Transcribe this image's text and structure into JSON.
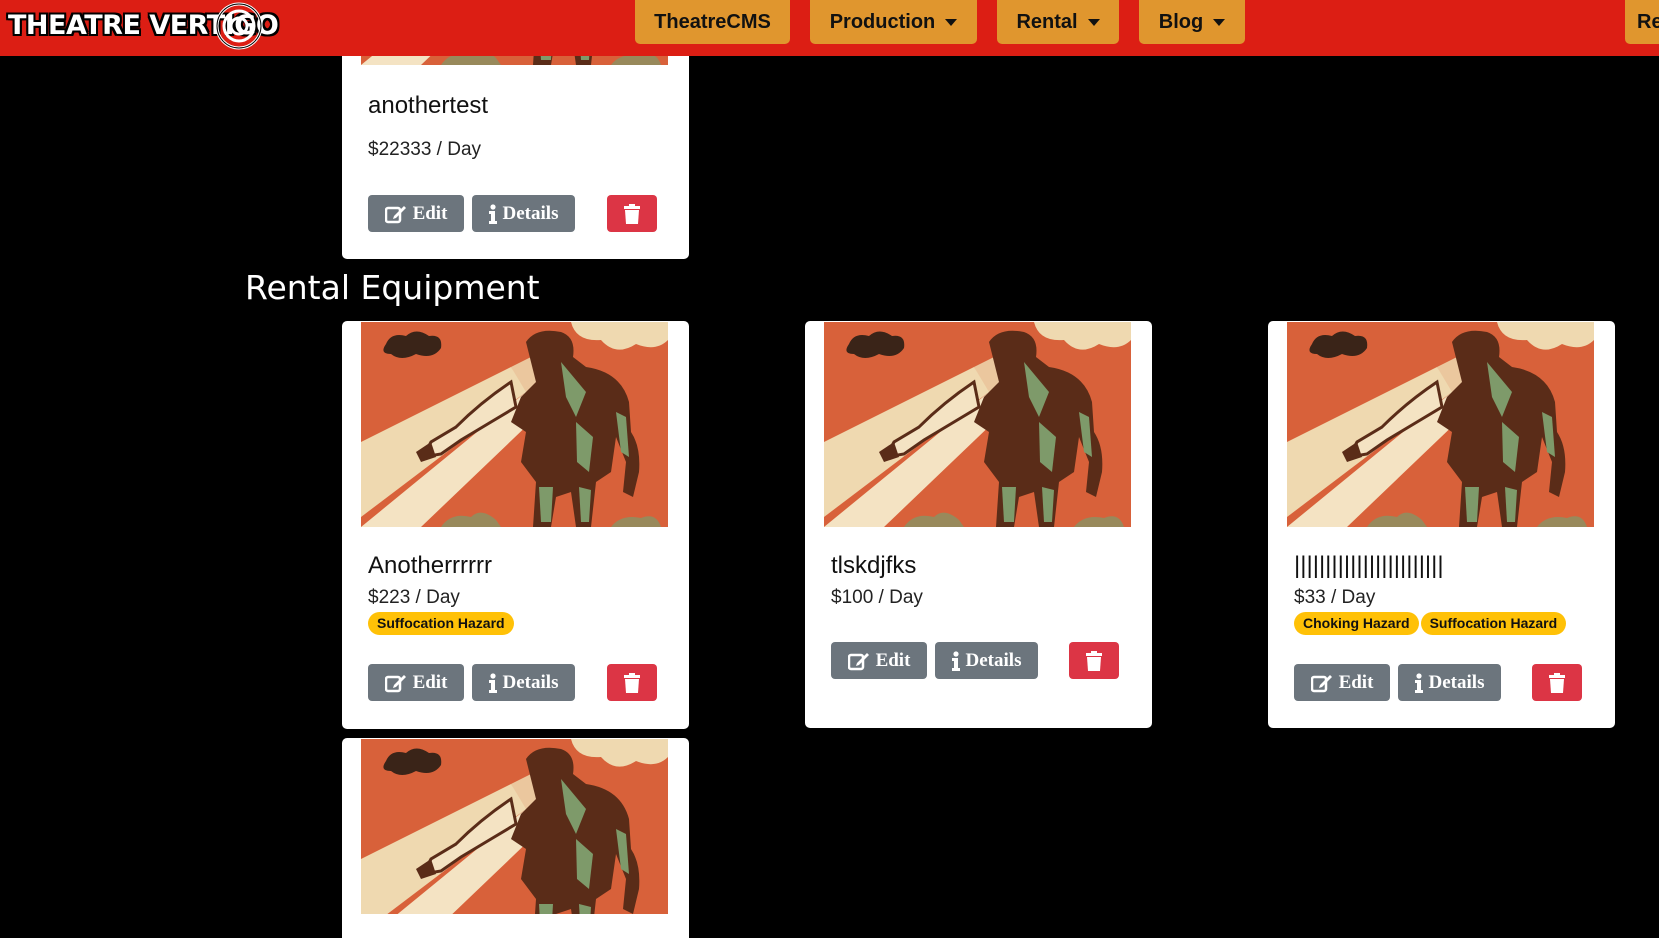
{
  "navbar": {
    "logo_text": "THEATRE VERTIGO",
    "items": [
      {
        "label": "TheatreCMS",
        "dropdown": false
      },
      {
        "label": "Production",
        "dropdown": true
      },
      {
        "label": "Rental",
        "dropdown": true
      },
      {
        "label": "Blog",
        "dropdown": true
      },
      {
        "label": "Re",
        "dropdown": false
      }
    ]
  },
  "top_card": {
    "title": "anothertest",
    "price": "$22333 / Day",
    "edit_label": "Edit",
    "details_label": "Details"
  },
  "section_heading": "Rental Equipment",
  "cards": [
    {
      "title": "Anotherrrrrr",
      "price": "$223 / Day",
      "badges": [
        "Suffocation Hazard"
      ],
      "edit_label": "Edit",
      "details_label": "Details"
    },
    {
      "title": "tlskdjfks",
      "price": "$100 / Day",
      "badges": [],
      "edit_label": "Edit",
      "details_label": "Details"
    },
    {
      "title": "||||||||||||||||||||||||",
      "price": "$33 / Day",
      "badges": [
        "Choking Hazard",
        "Suffocation Hazard"
      ],
      "edit_label": "Edit",
      "details_label": "Details"
    }
  ],
  "colors": {
    "navbar": "#dc1e14",
    "nav_button": "#e0962e",
    "edit_button": "#6c757d",
    "delete_button": "#dc3545",
    "badge": "#ffc107"
  },
  "icons": {
    "edit": "edit-icon",
    "details": "info-icon",
    "delete": "trash-icon"
  }
}
